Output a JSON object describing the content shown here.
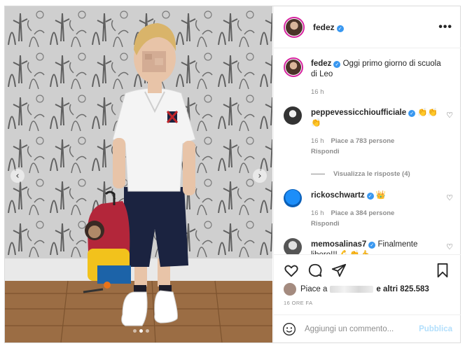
{
  "post": {
    "author": "fedez",
    "verified": true,
    "more_icon": "more-horizontal-icon"
  },
  "photo": {
    "nav_prev": "‹",
    "nav_next": "›",
    "dots_total": 3,
    "dots_active": 1
  },
  "caption": {
    "author": "fedez",
    "text": "Oggi primo giorno di scuola di Leo",
    "time": "16 h"
  },
  "comments": [
    {
      "author": "peppevessicchioufficiale",
      "text": "👏👏👏",
      "time": "16 h",
      "likes": "Piace a 783 persone",
      "reply": "Rispondi"
    },
    {
      "author": "rickoschwartz",
      "text": "👑",
      "time": "16 h",
      "likes": "Piace a 384 persone",
      "reply": "Rispondi"
    },
    {
      "author": "memosalinas7",
      "text": "Finalmente libero!!! 💪👏👍"
    }
  ],
  "view_replies": "Visualizza le risposte (4)",
  "likes": {
    "prefix": "Piace a",
    "suffix": "e altri 825.583"
  },
  "time_ago": "16 ORE FA",
  "add_comment": {
    "placeholder": "Aggiungi un commento...",
    "post_label": "Pubblica"
  },
  "colors": {
    "verified": "#3897f0",
    "post_button": "#b2dffc",
    "story_ring": "#d6249f",
    "secondary_text": "#8e8e8e"
  }
}
